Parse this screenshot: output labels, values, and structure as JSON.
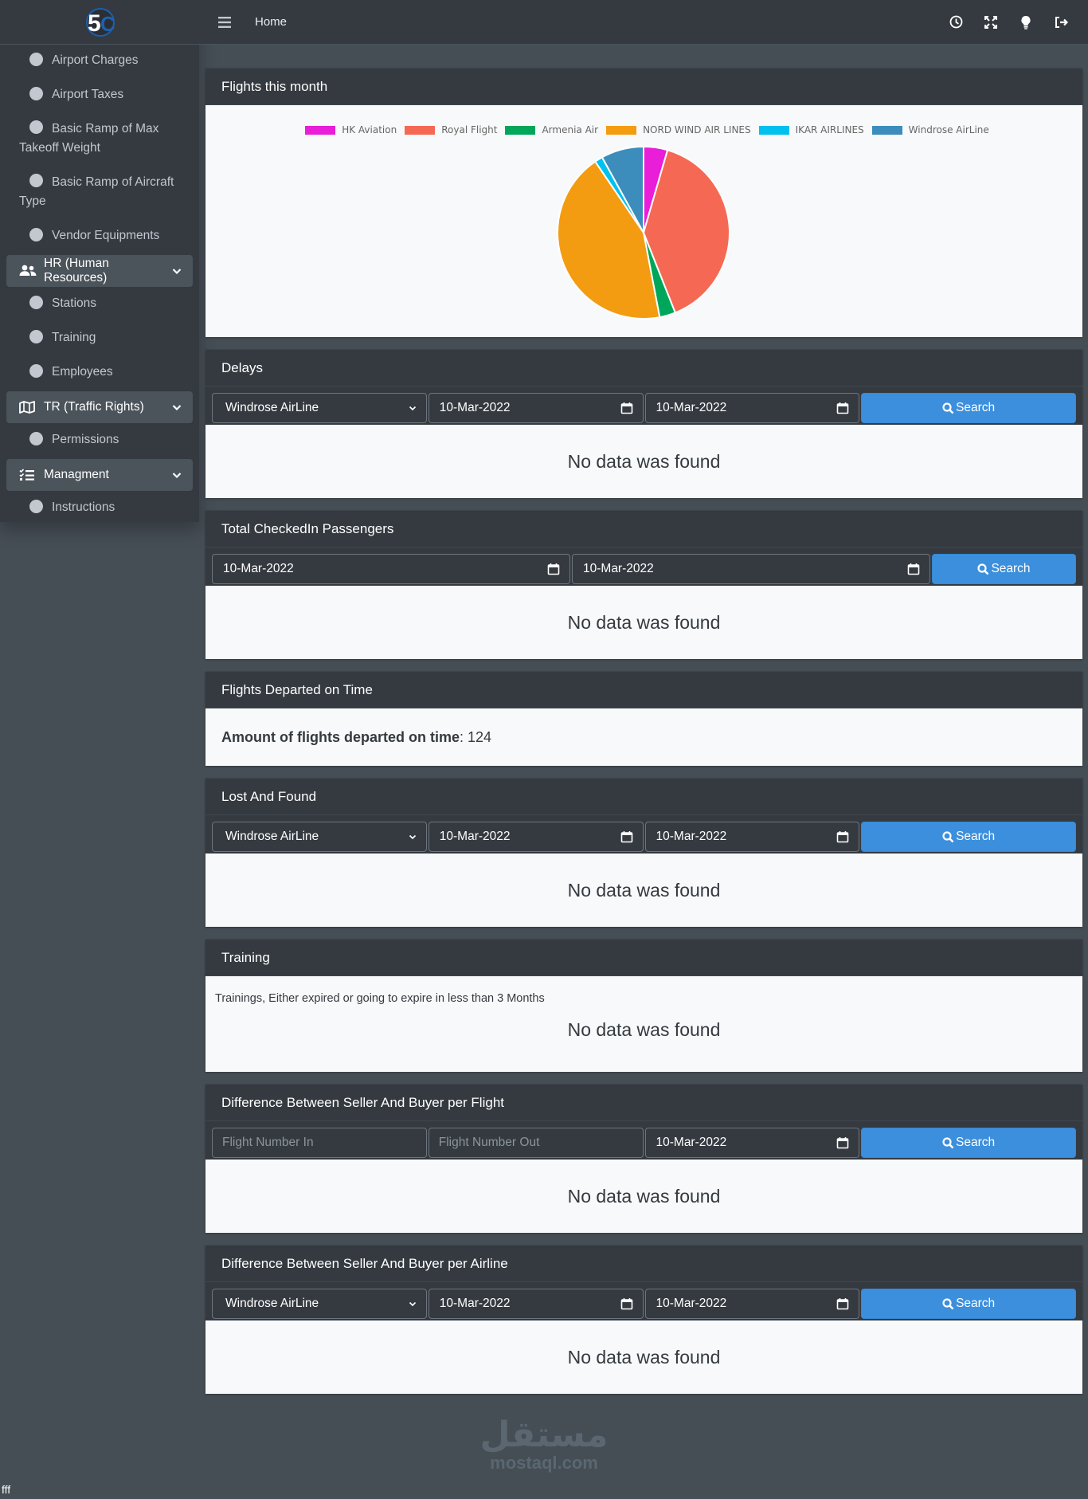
{
  "sidebar": {
    "items": [
      {
        "label": "Airport Charges"
      },
      {
        "label": "Airport Taxes"
      },
      {
        "label": "Basic Ramp of Max Takeoff Weight"
      },
      {
        "label": "Basic Ramp of Aircraft Type"
      },
      {
        "label": "Vendor Equipments"
      }
    ],
    "hr_group": {
      "label": "HR (Human Resources)",
      "icon": "users-icon"
    },
    "hr_items": [
      {
        "label": "Stations"
      },
      {
        "label": "Training"
      },
      {
        "label": "Employees"
      }
    ],
    "tr_group": {
      "label": "TR (Traffic Rights)",
      "icon": "map-icon"
    },
    "tr_items": [
      {
        "label": "Permissions"
      }
    ],
    "mgmt_group": {
      "label": "Managment",
      "icon": "tasks-icon"
    },
    "mgmt_items": [
      {
        "label": "Instructions"
      }
    ]
  },
  "topbar": {
    "home": "Home",
    "icons": [
      "history-icon",
      "fullscreen-icon",
      "lightbulb-icon",
      "signout-icon"
    ]
  },
  "flights_card": {
    "title": "Flights this month"
  },
  "chart_data": {
    "type": "pie",
    "title": "",
    "categories": [
      "HK Aviation",
      "Royal Flight",
      "Armenia Air",
      "NORD WIND AIR LINES",
      "IKAR AIRLINES",
      "Windrose AirLine"
    ],
    "values": [
      4.5,
      39.5,
      3,
      43.5,
      1.5,
      8
    ],
    "colors": [
      "#e81ed8",
      "#f56954",
      "#00a65a",
      "#f39c12",
      "#00c0ef",
      "#3c8dbc"
    ],
    "legend": "top"
  },
  "delays": {
    "title": "Delays",
    "airline": "Windrose AirLine",
    "from": "10-Mar-2022",
    "to": "10-Mar-2022",
    "search": "Search",
    "empty": "No data was found"
  },
  "checkedin": {
    "title": "Total CheckedIn Passengers",
    "from": "10-Mar-2022",
    "to": "10-Mar-2022",
    "search": "Search",
    "empty": "No data was found"
  },
  "ontime": {
    "title": "Flights Departed on Time",
    "label": "Amount of flights departed on time",
    "value": ": 124"
  },
  "lost": {
    "title": "Lost And Found",
    "airline": "Windrose AirLine",
    "from": "10-Mar-2022",
    "to": "10-Mar-2022",
    "search": "Search",
    "empty": "No data was found"
  },
  "training": {
    "title": "Training",
    "note": "Trainings, Either expired or going to expire in less than 3 Months",
    "empty": "No data was found"
  },
  "diff_flight": {
    "title": "Difference Between Seller And Buyer per Flight",
    "in_placeholder": "Flight Number In",
    "out_placeholder": "Flight Number Out",
    "date": "10-Mar-2022",
    "search": "Search",
    "empty": "No data was found"
  },
  "diff_airline": {
    "title": "Difference Between Seller And Buyer per Airline",
    "airline": "Windrose AirLine",
    "from": "10-Mar-2022",
    "to": "10-Mar-2022",
    "search": "Search",
    "empty": "No data was found"
  },
  "watermark": {
    "ar": "مستقل",
    "en": "mostaql.com"
  },
  "footer": "fff"
}
